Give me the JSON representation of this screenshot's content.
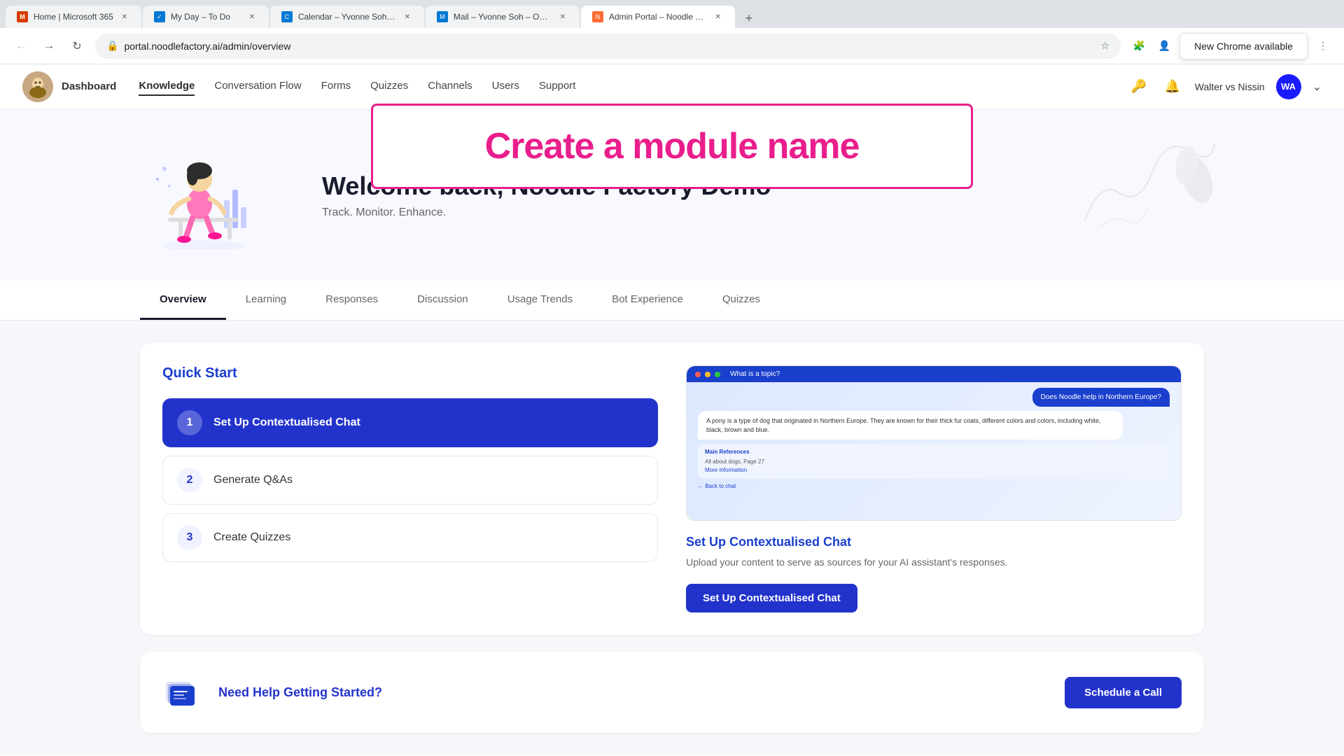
{
  "browser": {
    "tabs": [
      {
        "id": "tab1",
        "title": "Home | Microsoft 365",
        "favicon_color": "#d83b01",
        "active": false
      },
      {
        "id": "tab2",
        "title": "My Day – To Do",
        "favicon_color": "#0078d4",
        "active": false
      },
      {
        "id": "tab3",
        "title": "Calendar – Yvonne Soh – Out…",
        "favicon_color": "#0078d4",
        "active": false
      },
      {
        "id": "tab4",
        "title": "Mail – Yvonne Soh – Outlook",
        "favicon_color": "#0078d4",
        "active": false
      },
      {
        "id": "tab5",
        "title": "Admin Portal – Noodle Facto…",
        "favicon_color": "#ff6b35",
        "active": true
      }
    ],
    "address": "portal.noodlefactory.ai/admin/overview",
    "new_chrome_label": "New Chrome available"
  },
  "module_name_popup": {
    "text": "Create a module name"
  },
  "nav": {
    "dashboard_label": "Dashboard",
    "links": [
      {
        "label": "Knowledge",
        "active": true
      },
      {
        "label": "Conversation Flow",
        "active": false
      },
      {
        "label": "Forms",
        "active": false
      },
      {
        "label": "Quizzes",
        "active": false
      },
      {
        "label": "Channels",
        "active": false
      },
      {
        "label": "Users",
        "active": false
      },
      {
        "label": "Support",
        "active": false
      }
    ],
    "user_name": "Walter vs Nissin",
    "user_initials": "WA"
  },
  "hero": {
    "welcome": "Welcome back, Noodle Factory Demo",
    "subtitle": "Track. Monitor. Enhance."
  },
  "tabs": [
    {
      "label": "Overview",
      "active": true
    },
    {
      "label": "Learning",
      "active": false
    },
    {
      "label": "Responses",
      "active": false
    },
    {
      "label": "Discussion",
      "active": false
    },
    {
      "label": "Usage Trends",
      "active": false
    },
    {
      "label": "Bot Experience",
      "active": false
    },
    {
      "label": "Quizzes",
      "active": false
    }
  ],
  "quick_start": {
    "title": "Quick Start",
    "items": [
      {
        "num": "1",
        "label": "Set Up Contextualised Chat",
        "active": true
      },
      {
        "num": "2",
        "label": "Generate Q&As",
        "active": false
      },
      {
        "num": "3",
        "label": "Create Quizzes",
        "active": false
      }
    ],
    "preview_chat": {
      "bubbles": [
        {
          "text": "Does Noodle help in Northern Europe?",
          "type": "user"
        },
        {
          "text": "A pony is a type of dog that originated in Northern Europe. They are known for their thick fur coats, different colors and colors, including white, black, brown and blue.",
          "type": "bot"
        },
        {
          "text": "Main References\nAll about dogs, Page 27\nMore information",
          "type": "ref"
        }
      ]
    },
    "detail_title": "Set Up Contextualised Chat",
    "detail_text": "Upload your content to serve as sources for your AI assistant's responses.",
    "action_label": "Set Up Contextualised Chat"
  },
  "help": {
    "title": "Need Help Getting Started?",
    "button_label": "Schedule a Call"
  }
}
